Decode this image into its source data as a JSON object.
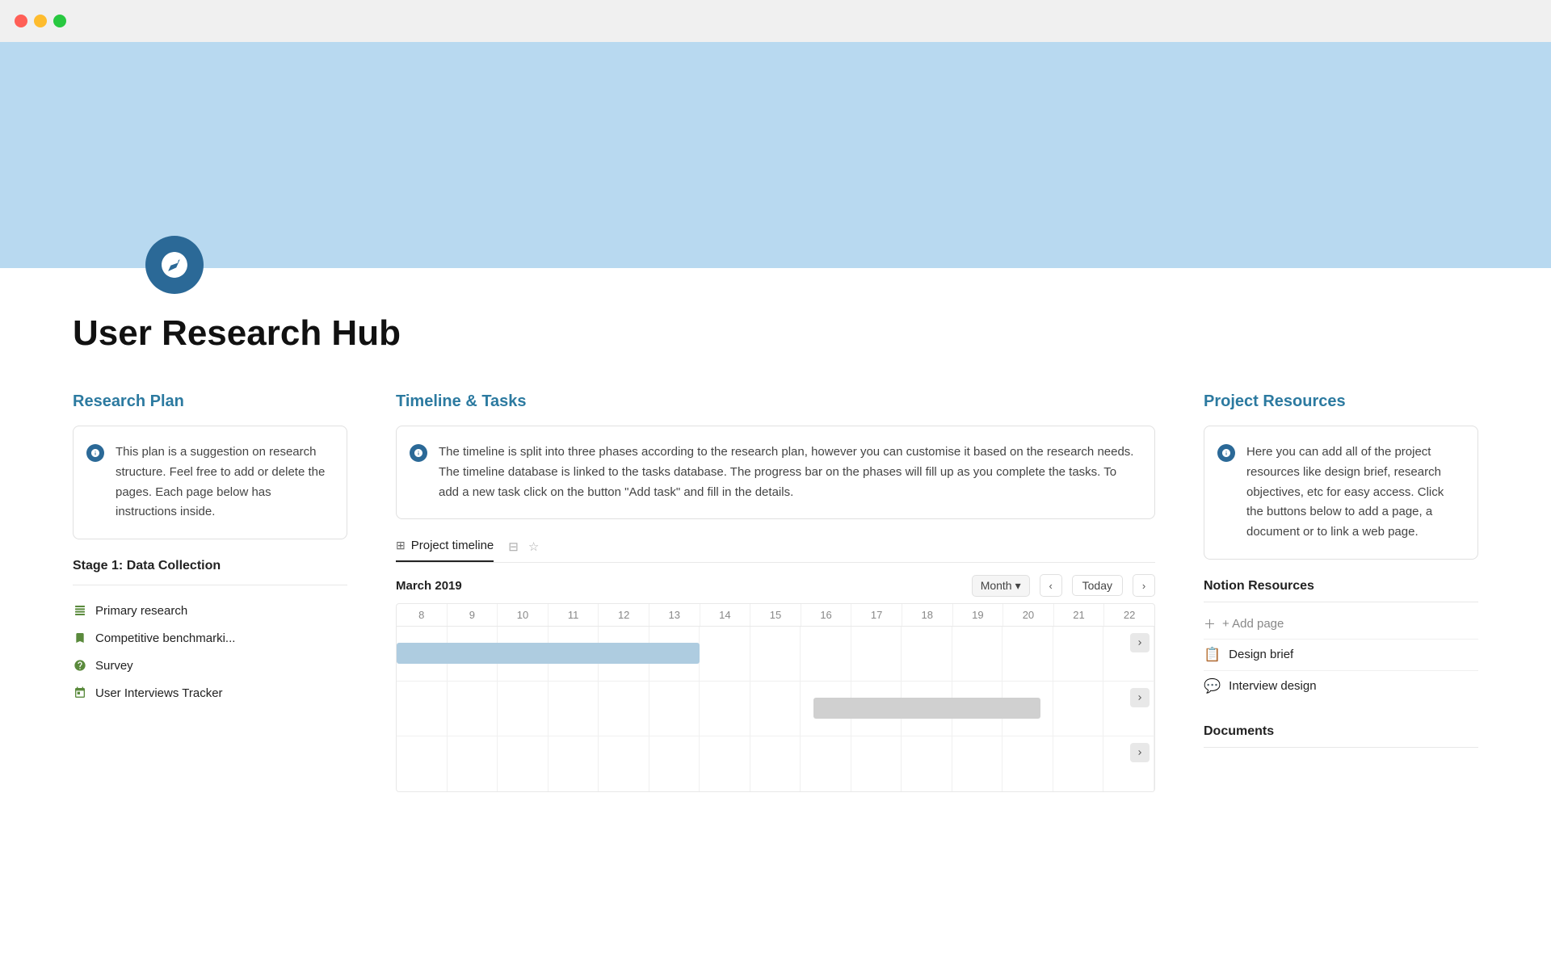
{
  "titlebar": {
    "dots": [
      "red",
      "yellow",
      "green"
    ]
  },
  "page": {
    "title": "User Research Hub",
    "icon_label": "compass-icon"
  },
  "research_plan": {
    "heading": "Research Plan",
    "info_text": "This plan is a suggestion on research structure. Feel free to add or delete the pages. Each page below has instructions inside.",
    "stage_label": "Stage 1: Data Collection",
    "items": [
      {
        "label": "Primary research",
        "icon": "table"
      },
      {
        "label": "Competitive benchmarki...",
        "icon": "bookmark"
      },
      {
        "label": "Survey",
        "icon": "question"
      },
      {
        "label": "User Interviews Tracker",
        "icon": "calendar"
      }
    ]
  },
  "timeline": {
    "heading": "Timeline & Tasks",
    "info_text": "The timeline is split into three phases according to the research plan, however you can customise it based on the research needs. The timeline database is linked to the tasks database. The progress bar on the phases will fill up as you complete the tasks. To add a new task click on the button \"Add task\" and fill in the details.",
    "tab_label": "Project timeline",
    "date": "March 2019",
    "view_label": "Month",
    "today_label": "Today",
    "day_numbers": [
      "8",
      "9",
      "10",
      "11",
      "12",
      "13",
      "14",
      "15",
      "16",
      "17",
      "18",
      "19",
      "20",
      "21",
      "22"
    ]
  },
  "resources": {
    "heading": "Project Resources",
    "info_text": "Here you can add all of the project resources like design brief, research objectives, etc for easy access. Click the buttons below to add a page, a document or to link a web page.",
    "notion_label": "Notion Resources",
    "add_page_label": "+ Add page",
    "items": [
      {
        "label": "Design brief",
        "icon": "📋"
      },
      {
        "label": "Interview design",
        "icon": "💬"
      }
    ],
    "documents_label": "Documents"
  }
}
